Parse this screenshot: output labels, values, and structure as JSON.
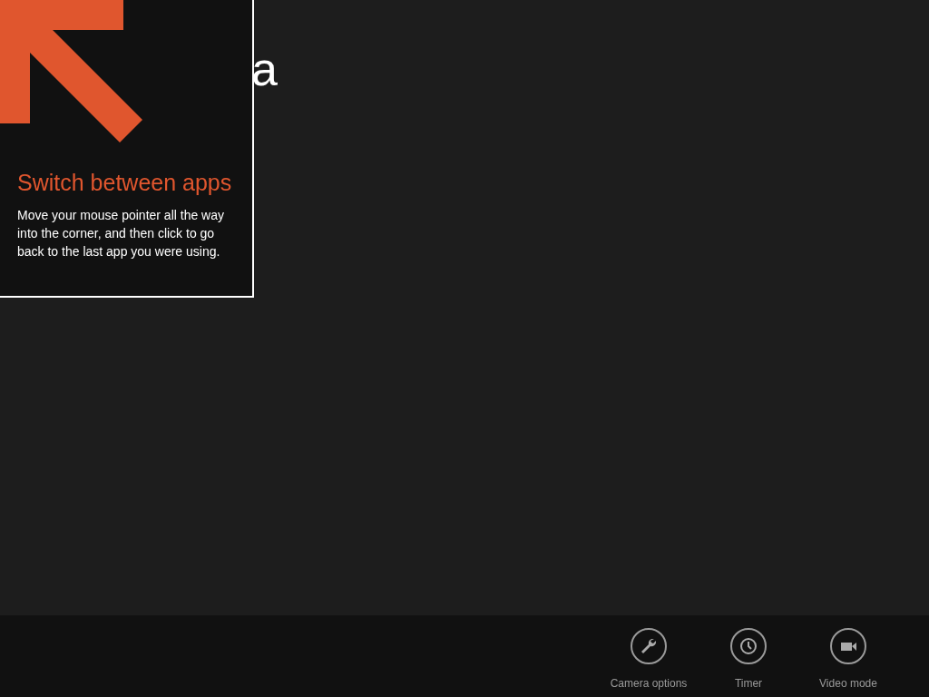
{
  "page_title": "a",
  "tip": {
    "title": "Switch between apps",
    "body": "Move your mouse pointer all the way into the corner, and then click to go back to the last app you were using."
  },
  "app_bar": [
    {
      "kind": "wrench",
      "label": "Camera options"
    },
    {
      "kind": "clock",
      "label": "Timer"
    },
    {
      "kind": "video",
      "label": "Video mode"
    }
  ]
}
